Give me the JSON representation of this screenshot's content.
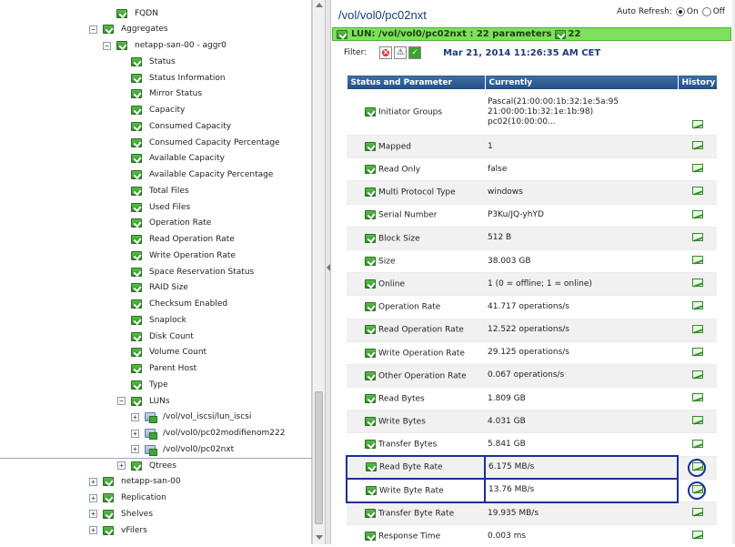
{
  "tree": {
    "items": [
      {
        "label": "FQDN",
        "level": 3,
        "expander": "",
        "icon": "status-icon"
      },
      {
        "label": "Aggregates",
        "level": 2,
        "expander": "−",
        "icon": "status-icon"
      },
      {
        "label": "netapp-san-00 - aggr0",
        "level": 3,
        "expander": "−",
        "icon": "status-icon"
      },
      {
        "label": "Status",
        "level": 4,
        "expander": "",
        "icon": "status-icon"
      },
      {
        "label": "Status Information",
        "level": 4,
        "expander": "",
        "icon": "status-icon"
      },
      {
        "label": "Mirror Status",
        "level": 4,
        "expander": "",
        "icon": "status-icon"
      },
      {
        "label": "Capacity",
        "level": 4,
        "expander": "",
        "icon": "status-icon"
      },
      {
        "label": "Consumed Capacity",
        "level": 4,
        "expander": "",
        "icon": "status-icon"
      },
      {
        "label": "Consumed Capacity Percentage",
        "level": 4,
        "expander": "",
        "icon": "status-icon"
      },
      {
        "label": "Available Capacity",
        "level": 4,
        "expander": "",
        "icon": "status-icon"
      },
      {
        "label": "Available Capacity Percentage",
        "level": 4,
        "expander": "",
        "icon": "status-icon"
      },
      {
        "label": "Total Files",
        "level": 4,
        "expander": "",
        "icon": "status-icon"
      },
      {
        "label": "Used Files",
        "level": 4,
        "expander": "",
        "icon": "status-icon"
      },
      {
        "label": "Operation Rate",
        "level": 4,
        "expander": "",
        "icon": "status-icon"
      },
      {
        "label": "Read Operation Rate",
        "level": 4,
        "expander": "",
        "icon": "status-icon"
      },
      {
        "label": "Write Operation Rate",
        "level": 4,
        "expander": "",
        "icon": "status-icon"
      },
      {
        "label": "Space Reservation Status",
        "level": 4,
        "expander": "",
        "icon": "status-icon"
      },
      {
        "label": "RAID Size",
        "level": 4,
        "expander": "",
        "icon": "status-icon"
      },
      {
        "label": "Checksum Enabled",
        "level": 4,
        "expander": "",
        "icon": "status-icon"
      },
      {
        "label": "Snaplock",
        "level": 4,
        "expander": "",
        "icon": "status-icon"
      },
      {
        "label": "Disk Count",
        "level": 4,
        "expander": "",
        "icon": "status-icon"
      },
      {
        "label": "Volume Count",
        "level": 4,
        "expander": "",
        "icon": "status-icon"
      },
      {
        "label": "Parent Host",
        "level": 4,
        "expander": "",
        "icon": "status-icon"
      },
      {
        "label": "Type",
        "level": 4,
        "expander": "",
        "icon": "status-icon"
      },
      {
        "label": "LUNs",
        "level": 4,
        "expander": "−",
        "icon": "status-icon"
      },
      {
        "label": "/vol/vol_iscsi/lun_iscsi",
        "level": 5,
        "expander": "+",
        "icon": "lun-icon"
      },
      {
        "label": "/vol/vol0/pc02modifienom222",
        "level": 5,
        "expander": "+",
        "icon": "lun-icon"
      },
      {
        "label": "/vol/vol0/pc02nxt",
        "level": 5,
        "expander": "+",
        "icon": "lun-icon"
      },
      {
        "label": "Qtrees",
        "level": 4,
        "expander": "+",
        "icon": "status-icon"
      },
      {
        "label": "netapp-san-00",
        "level": 2,
        "expander": "+",
        "icon": "status-icon"
      },
      {
        "label": "Replication",
        "level": 2,
        "expander": "+",
        "icon": "status-icon"
      },
      {
        "label": "Shelves",
        "level": 2,
        "expander": "+",
        "icon": "status-icon"
      },
      {
        "label": "vFilers",
        "level": 2,
        "expander": "+",
        "icon": "status-icon"
      }
    ],
    "selected_index": 27
  },
  "header": {
    "title": "/vol/vol0/pc02nxt",
    "auto_refresh_label": "Auto Refresh:",
    "on_label": "On",
    "off_label": "Off",
    "auto_refresh_selected": "On"
  },
  "lun_bar": {
    "text": "LUN: /vol/vol0/pc02nxt : 22 parameters",
    "ok_count": "22"
  },
  "filter": {
    "label": "Filter:",
    "date": "Mar 21, 2014 11:26:35 AM CET"
  },
  "table": {
    "columns": [
      "Status and Parameter",
      "Currently",
      "History"
    ],
    "rows": [
      {
        "name": "Initiator Groups",
        "value": "Pascal(21:00:00:1b:32:1e:5a:95\n21:00:00:1b:32:1e:1b:98)\npc02(10:00:00...",
        "tall": true
      },
      {
        "name": "Mapped",
        "value": "1"
      },
      {
        "name": "Read Only",
        "value": "false"
      },
      {
        "name": "Multi Protocol Type",
        "value": "windows"
      },
      {
        "name": "Serial Number",
        "value": "P3Ku/JQ-yhYD"
      },
      {
        "name": "Block Size",
        "value": "512 B"
      },
      {
        "name": "Size",
        "value": "38.003 GB"
      },
      {
        "name": "Online",
        "value": "1 (0 = offline; 1 = online)"
      },
      {
        "name": "Operation Rate",
        "value": "41.717 operations/s"
      },
      {
        "name": "Read Operation Rate",
        "value": "12.522 operations/s"
      },
      {
        "name": "Write Operation Rate",
        "value": "29.125 operations/s"
      },
      {
        "name": "Other Operation Rate",
        "value": "0.067 operations/s"
      },
      {
        "name": "Read Bytes",
        "value": "1.809 GB"
      },
      {
        "name": "Write Bytes",
        "value": "4.031 GB"
      },
      {
        "name": "Transfer Bytes",
        "value": "5.841 GB"
      },
      {
        "name": "Read Byte Rate",
        "value": "6.175 MB/s",
        "highlight": true
      },
      {
        "name": "Write Byte Rate",
        "value": "13.76 MB/s",
        "highlight": true
      },
      {
        "name": "Transfer Byte Rate",
        "value": "19.935 MB/s"
      },
      {
        "name": "Response Time",
        "value": "0.003 ms"
      }
    ]
  }
}
